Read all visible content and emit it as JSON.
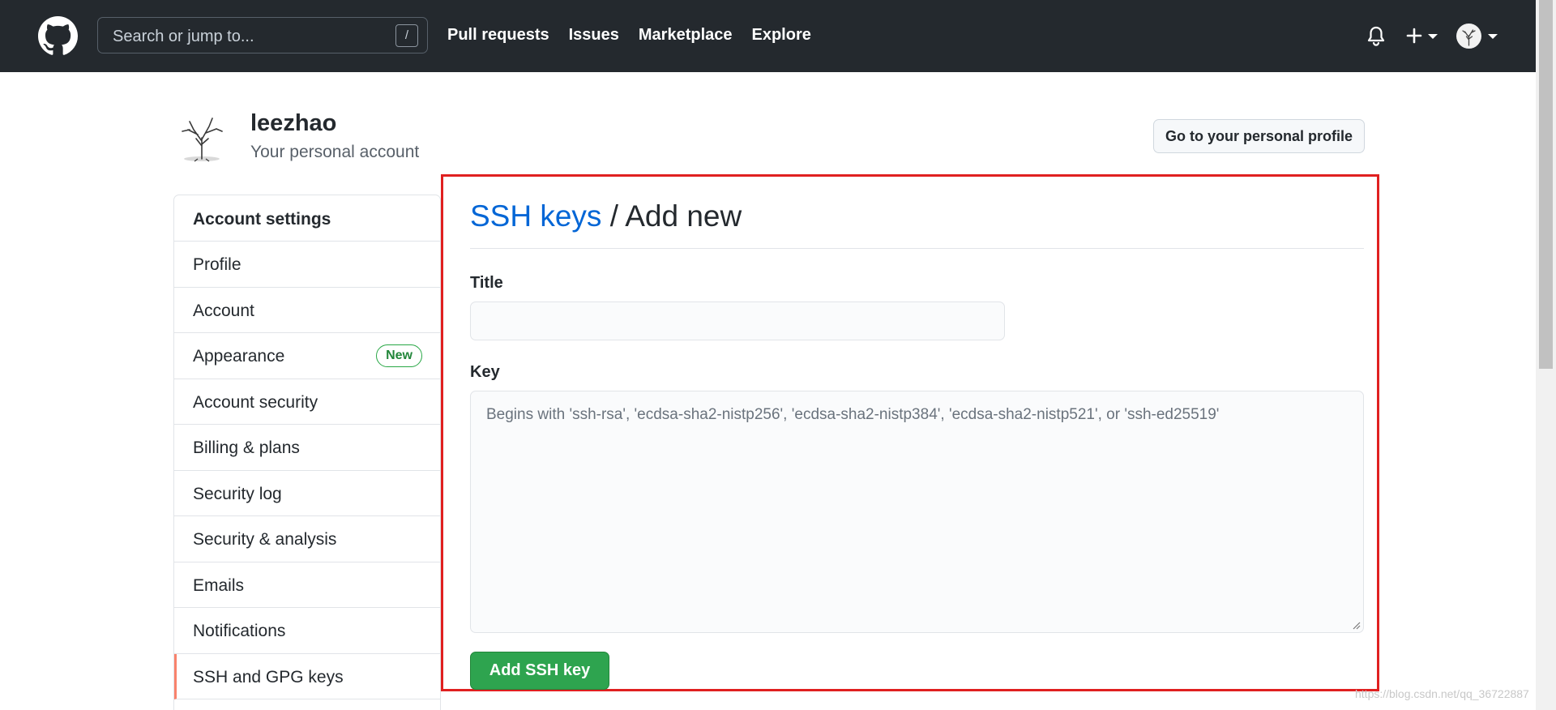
{
  "header": {
    "search_placeholder": "Search or jump to...",
    "search_shortcut": "/",
    "nav": [
      "Pull requests",
      "Issues",
      "Marketplace",
      "Explore"
    ]
  },
  "profile": {
    "username": "leezhao",
    "subtitle": "Your personal account",
    "profile_button": "Go to your personal profile"
  },
  "sidebar": {
    "heading": "Account settings",
    "items": [
      {
        "label": "Profile"
      },
      {
        "label": "Account"
      },
      {
        "label": "Appearance",
        "badge": "New"
      },
      {
        "label": "Account security"
      },
      {
        "label": "Billing & plans"
      },
      {
        "label": "Security log"
      },
      {
        "label": "Security & analysis"
      },
      {
        "label": "Emails"
      },
      {
        "label": "Notifications"
      },
      {
        "label": "SSH and GPG keys",
        "selected": true
      }
    ]
  },
  "main": {
    "title_link": "SSH keys",
    "title_rest": " / Add new",
    "title_label": "Title",
    "title_value": "",
    "key_label": "Key",
    "key_placeholder": "Begins with 'ssh-rsa', 'ecdsa-sha2-nistp256', 'ecdsa-sha2-nistp384', 'ecdsa-sha2-nistp521', or 'ssh-ed25519'",
    "submit_label": "Add SSH key"
  },
  "watermark": "https://blog.csdn.net/qq_36722887",
  "colors": {
    "header_bg": "#24292e",
    "link": "#0366d6",
    "primary_button": "#2ea44f",
    "highlight_border": "#e02020",
    "selected_accent": "#f9826c"
  },
  "icons": [
    "github-logo-icon",
    "bell-icon",
    "plus-icon",
    "chevron-down-icon",
    "avatar-icon"
  ]
}
